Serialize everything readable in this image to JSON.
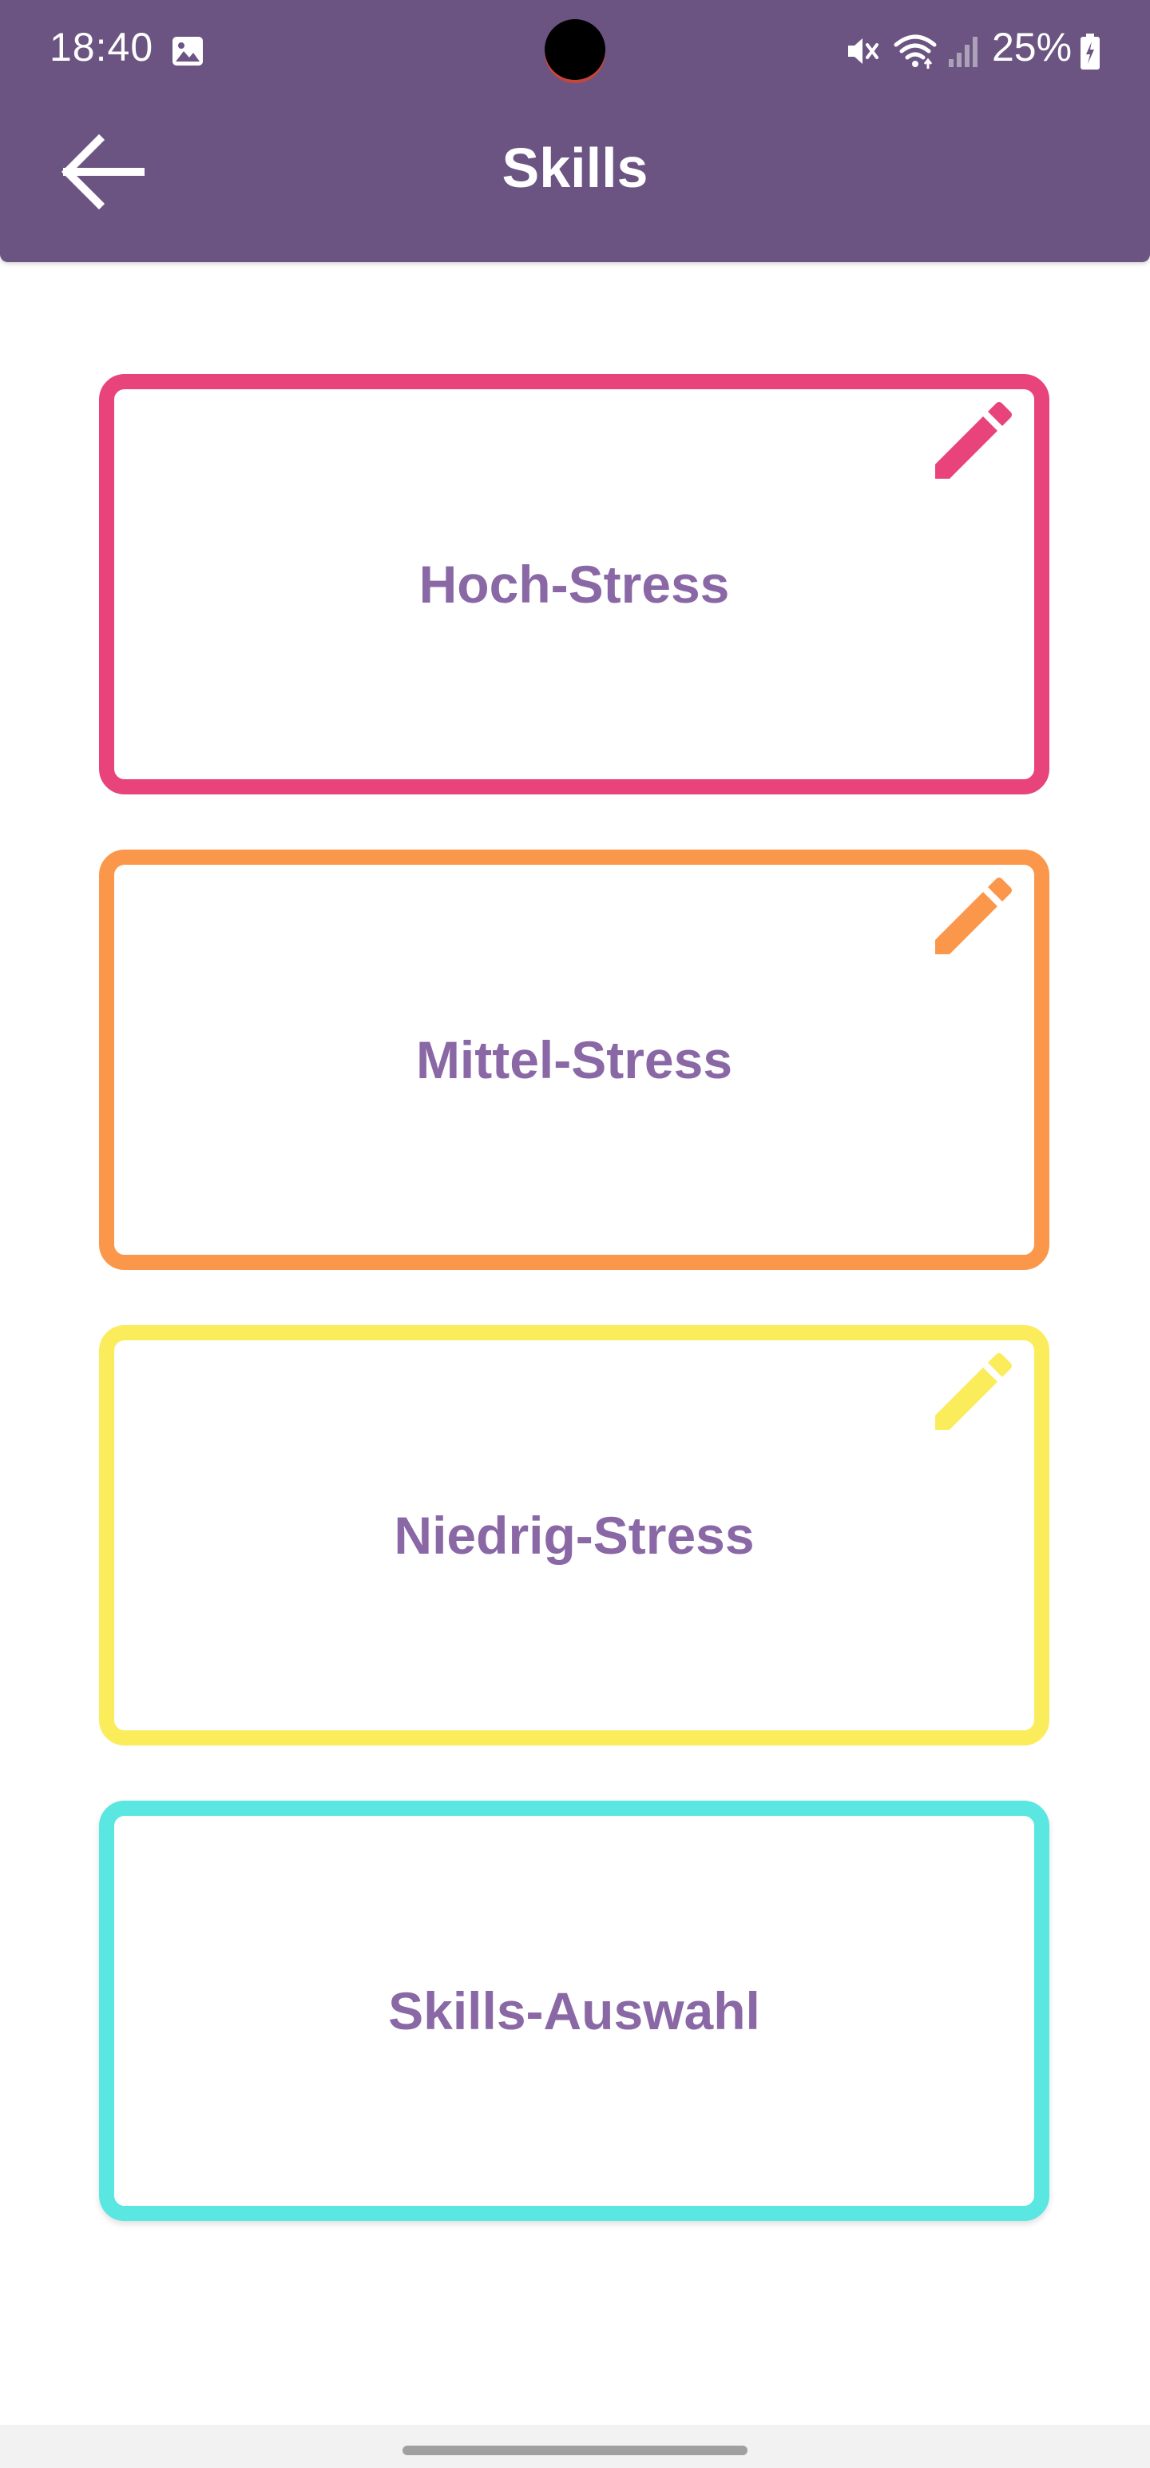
{
  "status_bar": {
    "time": "18:40",
    "battery": "25%",
    "icons": [
      "gallery-icon",
      "mute-icon",
      "wifi-icon",
      "signal-icon",
      "battery-icon"
    ]
  },
  "header": {
    "title": "Skills",
    "back_icon": "arrow-left-icon",
    "background_color": "#6b5482"
  },
  "cards": [
    {
      "label": "Hoch-Stress",
      "border_color": "#e8437a",
      "has_edit": true,
      "edit_icon": "pencil-icon"
    },
    {
      "label": "Mittel-Stress",
      "border_color": "#fb974a",
      "has_edit": true,
      "edit_icon": "pencil-icon"
    },
    {
      "label": "Niedrig-Stress",
      "border_color": "#fbec5b",
      "has_edit": true,
      "edit_icon": "pencil-icon"
    },
    {
      "label": "Skills-Auswahl",
      "border_color": "#5ae6e1",
      "has_edit": false
    }
  ],
  "colors": {
    "label_text": "#8a68a6",
    "background": "#ffffff"
  }
}
